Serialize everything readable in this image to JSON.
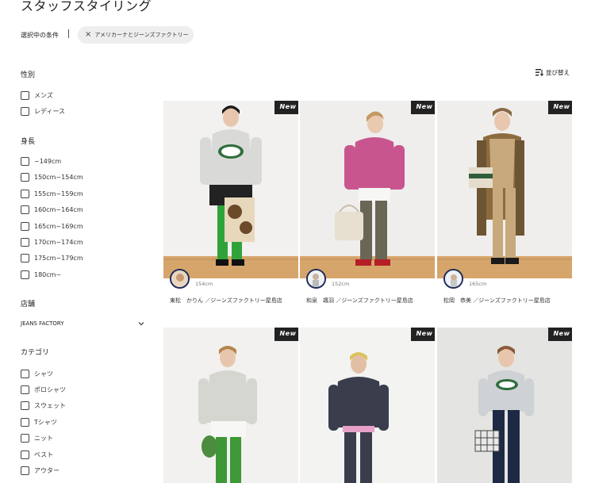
{
  "page_title": "スタッフスタイリング",
  "conditions": {
    "label": "選択中の条件",
    "chip": "アメリカーナとジーンズファクトリー"
  },
  "sort_label": "並び替え",
  "filters": {
    "gender": {
      "title": "性別",
      "options": [
        "メンズ",
        "レディース"
      ]
    },
    "height": {
      "title": "身長",
      "options": [
        "~149cm",
        "150cm~154cm",
        "155cm~159cm",
        "160cm~164cm",
        "165cm~169cm",
        "170cm~174cm",
        "175cm~179cm",
        "180cm~"
      ]
    },
    "store": {
      "title": "店舗",
      "selected": "JEANS FACTORY"
    },
    "category": {
      "title": "カテゴリ",
      "options": [
        "シャツ",
        "ポロシャツ",
        "スウェット",
        "Tシャツ",
        "ニット",
        "ベスト",
        "アウター"
      ]
    }
  },
  "badge": "New",
  "cards": [
    {
      "height": "154cm",
      "staff": "東松　かりん ／ジーンズファクトリー屋島店"
    },
    {
      "height": "152cm",
      "staff": "和泉　颯羽 ／ジーンズファクトリー屋島店"
    },
    {
      "height": "165cm",
      "staff": "松岡　恭美 ／ジーンズファクトリー屋島店"
    },
    {
      "height": "",
      "staff": ""
    },
    {
      "height": "",
      "staff": ""
    },
    {
      "height": "",
      "staff": ""
    }
  ],
  "colors": {
    "badge": "#222222",
    "chip_bg": "#eeeeee",
    "avatar_ring": "#1d2b5a",
    "floor": "#d9a66a"
  }
}
